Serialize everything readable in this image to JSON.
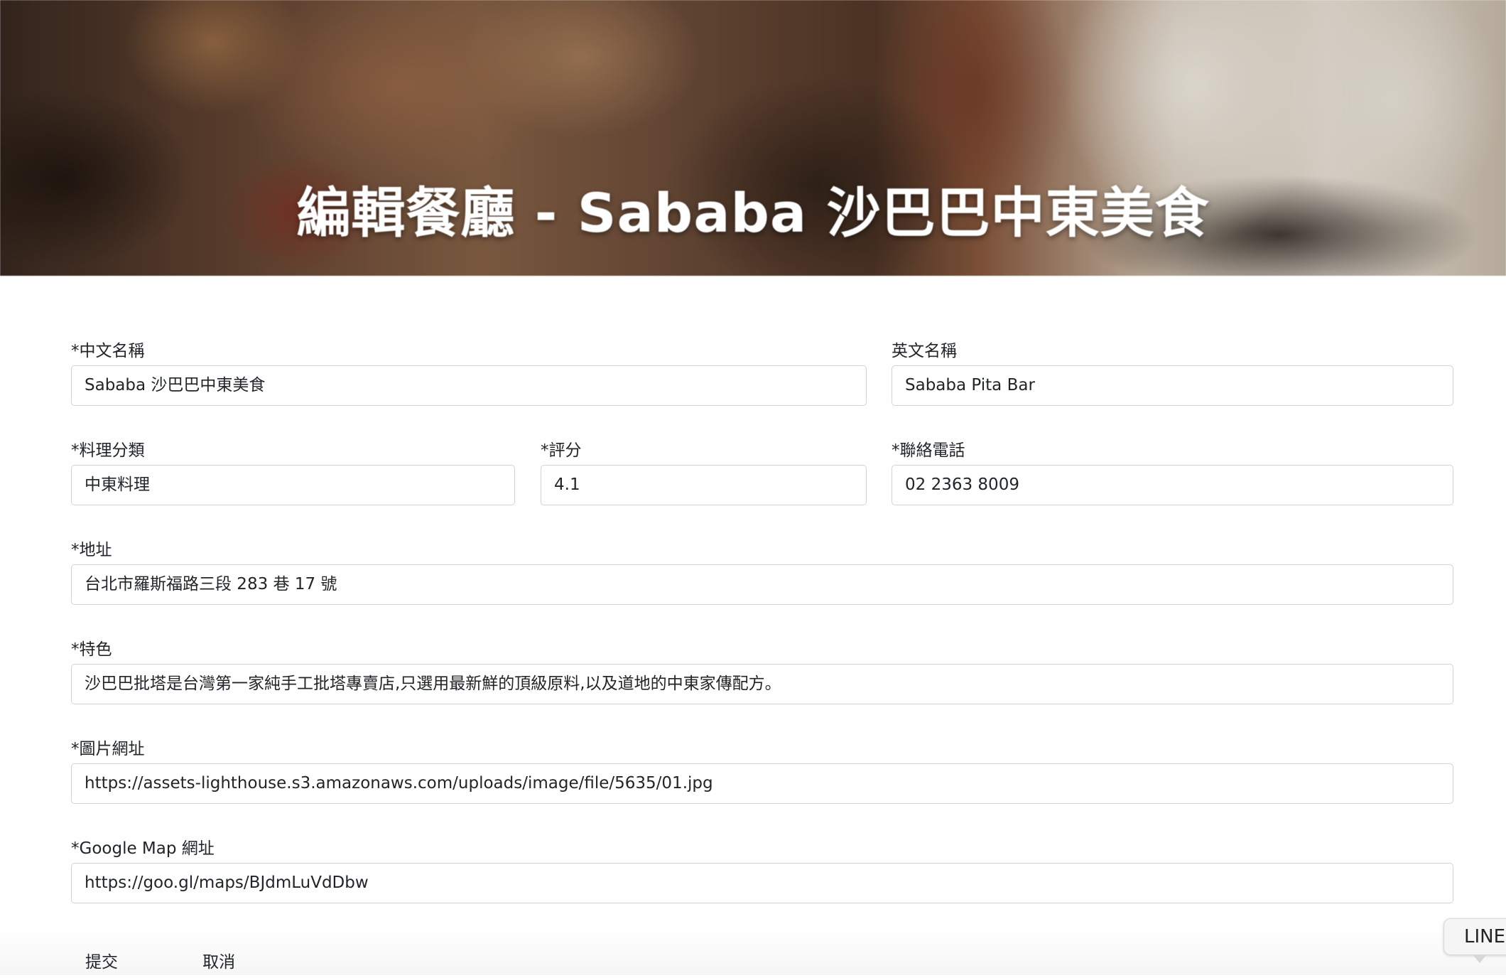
{
  "header": {
    "title": "編輯餐廳 - Sababa 沙巴巴中東美食"
  },
  "form": {
    "name": {
      "label": "*中文名稱",
      "value": "Sababa 沙巴巴中東美食"
    },
    "name_en": {
      "label": "英文名稱",
      "value": "Sababa Pita Bar"
    },
    "category": {
      "label": "*料理分類",
      "value": "中東料理"
    },
    "rating": {
      "label": "*評分",
      "value": "4.1"
    },
    "phone": {
      "label": "*聯絡電話",
      "value": "02 2363 8009"
    },
    "location": {
      "label": "*地址",
      "value": "台北市羅斯福路三段 283 巷 17 號"
    },
    "description": {
      "label": "*特色",
      "value": "沙巴巴批塔是台灣第一家純手工批塔專賣店,只選用最新鮮的頂級原料,以及道地的中東家傳配方。"
    },
    "image": {
      "label": "*圖片網址",
      "value": "https://assets-lighthouse.s3.amazonaws.com/uploads/image/file/5635/01.jpg"
    },
    "google_map": {
      "label": "*Google Map 網址",
      "value": "https://goo.gl/maps/BJdmLuVdDbw"
    }
  },
  "buttons": {
    "submit_label": "提交",
    "cancel_label": "取消"
  },
  "line_widget": {
    "label": "LINE"
  }
}
